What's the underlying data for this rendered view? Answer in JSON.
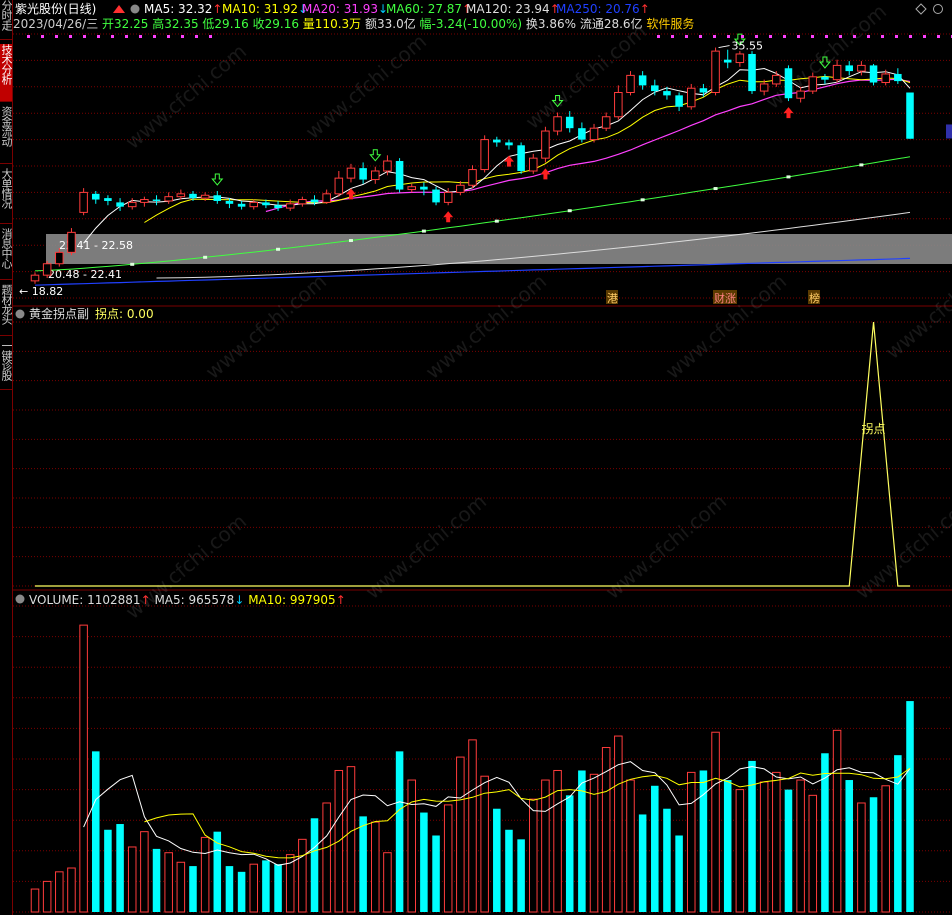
{
  "side_tabs": [
    {
      "label": "分时走势",
      "active": false
    },
    {
      "label": "技术分析",
      "active": true
    },
    {
      "label": "资金流动",
      "active": false
    },
    {
      "label": "大单情况",
      "active": false
    },
    {
      "label": "消息中心",
      "active": false
    },
    {
      "label": "题材龙头",
      "active": false
    },
    {
      "label": "一键诊股",
      "active": false
    }
  ],
  "header": {
    "stock_name": "紫光股份(日线)",
    "date": "2023/04/26/三",
    "open_label": "开",
    "open": "32.25",
    "high_label": "高",
    "high": "32.35",
    "low_label": "低",
    "low": "29.16",
    "close_label": "收",
    "close": "29.16",
    "vol_label": "量",
    "vol": "110.3万",
    "amt_label": "额",
    "amt": "33.0亿",
    "chg_label": "幅",
    "chg": "-3.24(-10.00%)",
    "turn_label": "换",
    "turn": "3.86%",
    "float_label": "流通",
    "float": "28.6亿",
    "sector": "软件服务"
  },
  "ma_legend": [
    {
      "text": "MA5: 32.32",
      "arrow": "↑",
      "color": "#ffffff",
      "arrow_color": "#ff3030"
    },
    {
      "text": "MA10: 31.92",
      "arrow": "↓",
      "color": "#ffff00",
      "arrow_color": "#00ccff"
    },
    {
      "text": "MA20: 31.93",
      "arrow": "↓",
      "color": "#ff40ff",
      "arrow_color": "#00ccff"
    },
    {
      "text": "MA60: 27.87",
      "arrow": "↑",
      "color": "#40ff40",
      "arrow_color": "#ff3030"
    },
    {
      "text": "MA120: 23.94",
      "arrow": "↑",
      "color": "#dddddd",
      "arrow_color": "#ff3030"
    },
    {
      "text": "MA250: 20.76",
      "arrow": "↑",
      "color": "#2040ff",
      "arrow_color": "#ff3030"
    }
  ],
  "price_annotations": {
    "high_mark": "35.55",
    "low_mark": "18.82",
    "range1": "22.41 - 22.58",
    "range2": "20.48 - 22.41",
    "tags": [
      "港",
      "财涨",
      "榜"
    ]
  },
  "indicator": {
    "title": "黄金拐点副",
    "value_label": "拐点: 0.00",
    "peak_label": "拐点"
  },
  "volume": {
    "title": "VOLUME: 1102881",
    "title_arrow": "↑",
    "ma5": "MA5: 965578",
    "ma5_arrow": "↓",
    "ma10": "MA10: 997905",
    "ma10_arrow": "↑"
  },
  "watermark": "www.cfchi.com",
  "colors": {
    "up": "#ff3c3c",
    "down": "#00ffff",
    "grid": "#7a0000"
  },
  "chart_data": {
    "type": "candlestick",
    "y_range": [
      18.0,
      36.5
    ],
    "candles": [
      {
        "o": 19.2,
        "c": 19.6,
        "h": 19.8,
        "l": 19.0
      },
      {
        "o": 19.6,
        "c": 20.4,
        "h": 20.6,
        "l": 19.4
      },
      {
        "o": 20.4,
        "c": 21.2,
        "h": 21.5,
        "l": 20.2
      },
      {
        "o": 21.2,
        "c": 22.6,
        "h": 22.9,
        "l": 21.0
      },
      {
        "o": 24.0,
        "c": 25.4,
        "h": 25.7,
        "l": 23.8
      },
      {
        "o": 25.3,
        "c": 24.9,
        "h": 25.5,
        "l": 24.6
      },
      {
        "o": 25.0,
        "c": 24.8,
        "h": 25.2,
        "l": 24.5
      },
      {
        "o": 24.7,
        "c": 24.4,
        "h": 25.0,
        "l": 24.1
      },
      {
        "o": 24.4,
        "c": 24.7,
        "h": 25.0,
        "l": 24.2
      },
      {
        "o": 24.7,
        "c": 24.9,
        "h": 25.1,
        "l": 24.4
      },
      {
        "o": 24.9,
        "c": 24.8,
        "h": 25.2,
        "l": 24.5
      },
      {
        "o": 24.8,
        "c": 25.1,
        "h": 25.4,
        "l": 24.6
      },
      {
        "o": 25.1,
        "c": 25.3,
        "h": 25.6,
        "l": 24.9
      },
      {
        "o": 25.3,
        "c": 25.0,
        "h": 25.5,
        "l": 24.8
      },
      {
        "o": 25.0,
        "c": 25.2,
        "h": 25.4,
        "l": 24.8
      },
      {
        "o": 25.2,
        "c": 24.8,
        "h": 25.5,
        "l": 24.6
      },
      {
        "o": 24.8,
        "c": 24.6,
        "h": 25.0,
        "l": 24.3
      },
      {
        "o": 24.6,
        "c": 24.4,
        "h": 24.8,
        "l": 24.2
      },
      {
        "o": 24.4,
        "c": 24.7,
        "h": 24.9,
        "l": 24.2
      },
      {
        "o": 24.7,
        "c": 24.5,
        "h": 24.9,
        "l": 24.3
      },
      {
        "o": 24.5,
        "c": 24.3,
        "h": 24.8,
        "l": 24.1
      },
      {
        "o": 24.3,
        "c": 24.6,
        "h": 24.9,
        "l": 24.1
      },
      {
        "o": 24.6,
        "c": 24.9,
        "h": 25.1,
        "l": 24.4
      },
      {
        "o": 24.9,
        "c": 24.7,
        "h": 25.2,
        "l": 24.5
      },
      {
        "o": 24.7,
        "c": 25.3,
        "h": 25.6,
        "l": 24.6
      },
      {
        "o": 25.3,
        "c": 26.4,
        "h": 26.9,
        "l": 25.1
      },
      {
        "o": 26.4,
        "c": 27.1,
        "h": 27.4,
        "l": 26.1
      },
      {
        "o": 27.1,
        "c": 26.3,
        "h": 27.5,
        "l": 26.0
      },
      {
        "o": 26.3,
        "c": 26.9,
        "h": 27.2,
        "l": 26.0
      },
      {
        "o": 26.9,
        "c": 27.6,
        "h": 28.0,
        "l": 26.6
      },
      {
        "o": 27.6,
        "c": 25.6,
        "h": 27.8,
        "l": 25.4
      },
      {
        "o": 25.6,
        "c": 25.8,
        "h": 26.0,
        "l": 25.4
      },
      {
        "o": 25.8,
        "c": 25.6,
        "h": 26.1,
        "l": 25.2
      },
      {
        "o": 25.6,
        "c": 24.7,
        "h": 25.8,
        "l": 24.5
      },
      {
        "o": 24.7,
        "c": 25.4,
        "h": 25.7,
        "l": 24.5
      },
      {
        "o": 25.4,
        "c": 25.9,
        "h": 26.2,
        "l": 25.2
      },
      {
        "o": 25.9,
        "c": 27.0,
        "h": 27.3,
        "l": 25.7
      },
      {
        "o": 27.0,
        "c": 29.1,
        "h": 29.4,
        "l": 26.8
      },
      {
        "o": 29.1,
        "c": 28.9,
        "h": 29.3,
        "l": 28.6
      },
      {
        "o": 28.9,
        "c": 28.7,
        "h": 29.1,
        "l": 28.4
      },
      {
        "o": 28.7,
        "c": 26.9,
        "h": 28.9,
        "l": 26.7
      },
      {
        "o": 26.9,
        "c": 27.8,
        "h": 28.1,
        "l": 26.7
      },
      {
        "o": 27.8,
        "c": 29.7,
        "h": 30.0,
        "l": 27.5
      },
      {
        "o": 29.7,
        "c": 30.7,
        "h": 31.0,
        "l": 29.4
      },
      {
        "o": 30.7,
        "c": 29.9,
        "h": 31.1,
        "l": 29.6
      },
      {
        "o": 29.9,
        "c": 29.1,
        "h": 30.3,
        "l": 28.9
      },
      {
        "o": 29.1,
        "c": 29.9,
        "h": 30.2,
        "l": 28.9
      },
      {
        "o": 29.9,
        "c": 30.7,
        "h": 31.0,
        "l": 29.7
      },
      {
        "o": 30.7,
        "c": 32.4,
        "h": 32.9,
        "l": 30.5
      },
      {
        "o": 32.4,
        "c": 33.6,
        "h": 33.9,
        "l": 32.2
      },
      {
        "o": 33.6,
        "c": 32.9,
        "h": 33.9,
        "l": 32.6
      },
      {
        "o": 32.9,
        "c": 32.5,
        "h": 33.3,
        "l": 32.2
      },
      {
        "o": 32.5,
        "c": 32.2,
        "h": 32.8,
        "l": 31.9
      },
      {
        "o": 32.2,
        "c": 31.4,
        "h": 32.4,
        "l": 31.1
      },
      {
        "o": 31.4,
        "c": 32.7,
        "h": 33.0,
        "l": 31.2
      },
      {
        "o": 32.7,
        "c": 32.4,
        "h": 33.0,
        "l": 32.1
      },
      {
        "o": 32.4,
        "c": 35.3,
        "h": 35.55,
        "l": 32.2
      },
      {
        "o": 34.7,
        "c": 34.5,
        "h": 35.4,
        "l": 34.1
      },
      {
        "o": 34.5,
        "c": 35.1,
        "h": 35.3,
        "l": 34.2
      },
      {
        "o": 35.1,
        "c": 32.5,
        "h": 35.3,
        "l": 32.3
      },
      {
        "o": 32.5,
        "c": 33.0,
        "h": 33.3,
        "l": 32.2
      },
      {
        "o": 33.0,
        "c": 33.6,
        "h": 33.9,
        "l": 32.8
      },
      {
        "o": 34.1,
        "c": 32.0,
        "h": 34.3,
        "l": 31.8
      },
      {
        "o": 32.0,
        "c": 32.5,
        "h": 32.8,
        "l": 31.7
      },
      {
        "o": 32.5,
        "c": 33.5,
        "h": 33.8,
        "l": 32.3
      },
      {
        "o": 33.5,
        "c": 33.3,
        "h": 33.7,
        "l": 33.0
      },
      {
        "o": 33.3,
        "c": 34.3,
        "h": 34.7,
        "l": 33.1
      },
      {
        "o": 34.3,
        "c": 33.9,
        "h": 34.6,
        "l": 33.6
      },
      {
        "o": 33.9,
        "c": 34.3,
        "h": 34.6,
        "l": 33.6
      },
      {
        "o": 34.3,
        "c": 33.1,
        "h": 34.4,
        "l": 32.9
      },
      {
        "o": 33.1,
        "c": 33.7,
        "h": 34.0,
        "l": 32.9
      },
      {
        "o": 33.7,
        "c": 33.2,
        "h": 34.1,
        "l": 33.0
      },
      {
        "o": 32.4,
        "c": 29.16,
        "h": 32.35,
        "l": 29.16
      }
    ],
    "volume_range": [
      0,
      1600000
    ],
    "volumes": [
      120000,
      160000,
      210000,
      230000,
      1500000,
      840000,
      430000,
      460000,
      340000,
      420000,
      330000,
      310000,
      260000,
      240000,
      390000,
      420000,
      240000,
      210000,
      250000,
      270000,
      250000,
      300000,
      380000,
      490000,
      570000,
      740000,
      760000,
      500000,
      470000,
      310000,
      840000,
      690000,
      520000,
      400000,
      560000,
      810000,
      900000,
      710000,
      540000,
      430000,
      380000,
      590000,
      690000,
      740000,
      610000,
      740000,
      720000,
      860000,
      920000,
      690000,
      510000,
      660000,
      540000,
      400000,
      730000,
      740000,
      940000,
      690000,
      640000,
      790000,
      680000,
      730000,
      640000,
      690000,
      610000,
      830000,
      950000,
      690000,
      570000,
      600000,
      660000,
      820000,
      1102881
    ],
    "indicator_range": [
      0,
      1
    ],
    "indicator_peak_index": 69,
    "indicator_values_note": ""
  }
}
